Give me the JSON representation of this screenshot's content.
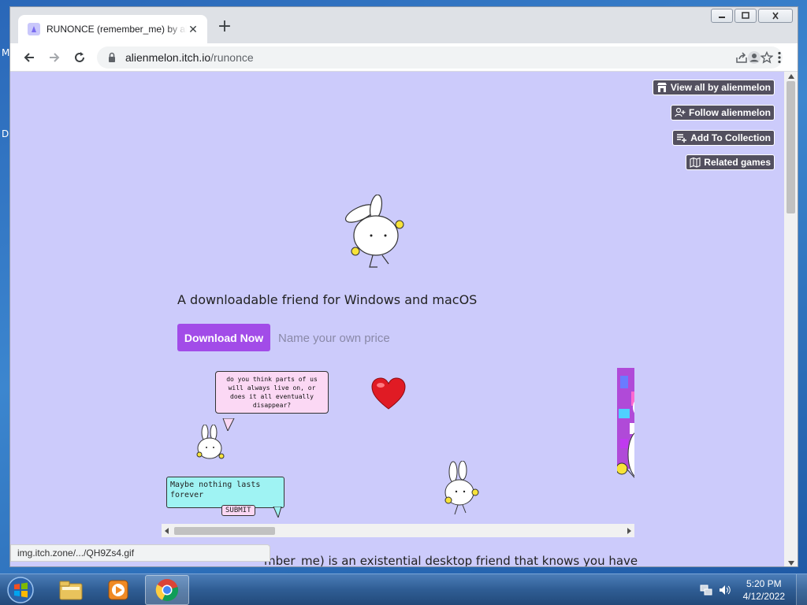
{
  "desktop": {
    "letters": [
      "M",
      "D"
    ]
  },
  "browser": {
    "tab": {
      "title": "RUNONCE (remember_me) by alienmelon"
    },
    "address": {
      "host": "alienmelon.itch.io",
      "path": "/runonce"
    }
  },
  "page": {
    "colors": {
      "background": "#cccbfb",
      "accent": "#a24ce8",
      "button_bg": "#53505f"
    },
    "top_buttons": [
      {
        "label": "View all by alienmelon",
        "icon": "store-icon"
      },
      {
        "label": "Follow alienmelon",
        "icon": "add-user-icon"
      },
      {
        "label": "Add To Collection",
        "icon": "playlist-add-icon"
      },
      {
        "label": "Related games",
        "icon": "map-icon"
      }
    ],
    "tagline": "A downloadable friend for Windows and macOS",
    "download_label": "Download Now",
    "price_label": "Name your own price",
    "screenshot": {
      "speech_text": "do you think parts of us will always live on, or does it all eventually disappear?",
      "reply_text": "Maybe nothing lasts forever",
      "submit_label": "SUBMIT"
    },
    "description_partial": "mber_me) is an existential desktop friend that knows you have",
    "status_url": "img.itch.zone/.../QH9Zs4.gif"
  },
  "taskbar": {
    "time": "5:20 PM",
    "date": "4/12/2022",
    "items": [
      "file-explorer-icon",
      "media-player-icon",
      "chrome-icon"
    ]
  }
}
